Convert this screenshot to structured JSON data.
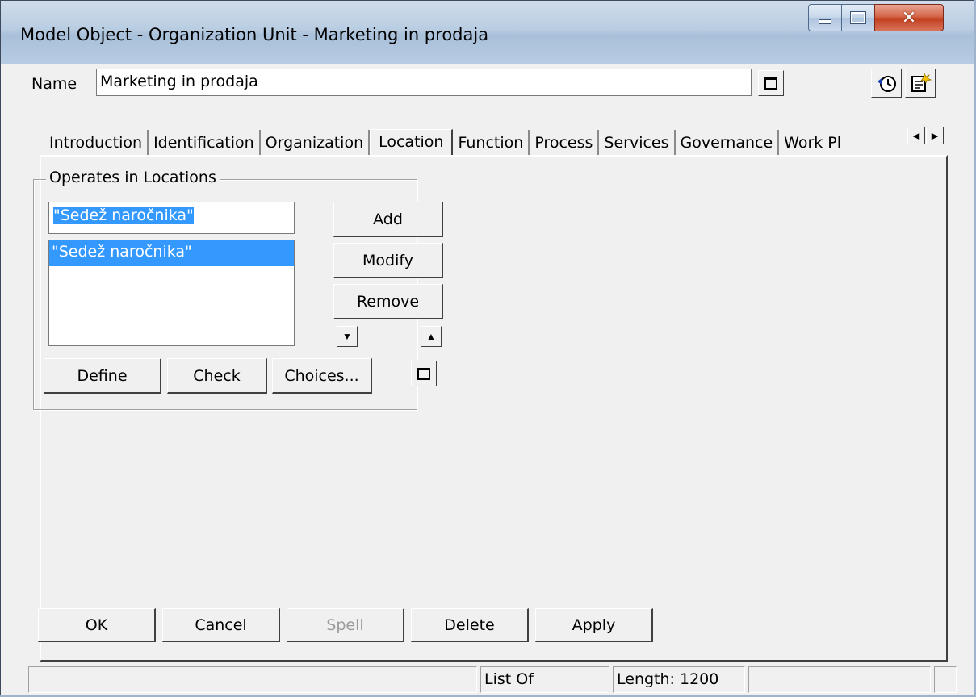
{
  "window": {
    "title": "Model Object - Organization Unit - Marketing in prodaja"
  },
  "name_row": {
    "label": "Name",
    "value": "Marketing in prodaja"
  },
  "tabs": [
    {
      "label": "Introduction"
    },
    {
      "label": "Identification"
    },
    {
      "label": "Organization"
    },
    {
      "label": "Location",
      "active": true
    },
    {
      "label": "Function"
    },
    {
      "label": "Process"
    },
    {
      "label": "Services"
    },
    {
      "label": "Governance"
    },
    {
      "label": "Work Pl"
    }
  ],
  "locations": {
    "group_label": "Operates in Locations",
    "input_value": "\"Sedež naročnika\"",
    "items": [
      "\"Sedež naročnika\""
    ],
    "add_label": "Add",
    "modify_label": "Modify",
    "remove_label": "Remove",
    "define_label": "Define",
    "check_label": "Check",
    "choices_label": "Choices..."
  },
  "buttons": {
    "ok": "OK",
    "cancel": "Cancel",
    "spell": "Spell",
    "delete": "Delete",
    "apply": "Apply"
  },
  "status": {
    "list_of": "List Of",
    "length": "Length: 1200"
  },
  "colors": {
    "selection": "#3399ff",
    "face": "#f0f0f0",
    "close": "#c2401f"
  }
}
